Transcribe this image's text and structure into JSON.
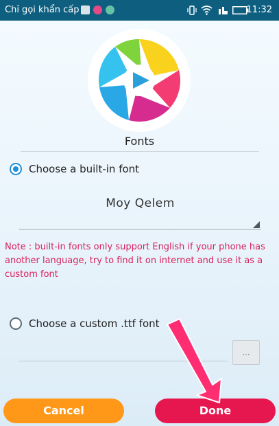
{
  "status_bar": {
    "carrier": "Chỉ gọi khẩn cấp",
    "time": "11:32"
  },
  "dialog": {
    "title": "Fonts",
    "builtin_option": {
      "label": "Choose a built-in font",
      "selected": true
    },
    "font_select": {
      "value": "Moy Qelem"
    },
    "note": "Note : built-in fonts only support English if your phone has another language, try to find it on internet and use it as a custom font",
    "custom_option": {
      "label": "Choose a custom .ttf font",
      "selected": false
    },
    "path_input": {
      "value": ""
    },
    "browse_label": "..."
  },
  "buttons": {
    "cancel": "Cancel",
    "done": "Done"
  },
  "colors": {
    "status_bar": "#0e5f7f",
    "accent": "#1e8fdc",
    "note": "#d8215d",
    "cancel": "#ff9818",
    "done": "#e6164f"
  }
}
